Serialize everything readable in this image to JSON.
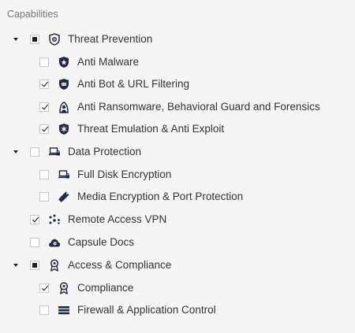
{
  "panel": {
    "title": "Capabilities"
  },
  "tree": {
    "threat_prevention": {
      "label": "Threat Prevention",
      "state": "partial",
      "expanded": true,
      "icon": "shield-gear-icon",
      "children": {
        "anti_malware": {
          "label": "Anti Malware",
          "state": "unchecked",
          "icon": "shield-bug-icon"
        },
        "anti_bot": {
          "label": "Anti Bot & URL Filtering",
          "state": "checked",
          "icon": "shield-bot-icon"
        },
        "anti_ransomware": {
          "label": "Anti Ransomware, Behavioral Guard and Forensics",
          "state": "checked",
          "icon": "hooded-figure-icon"
        },
        "threat_emulation": {
          "label": "Threat Emulation & Anti Exploit",
          "state": "checked",
          "icon": "sparkle-shield-icon"
        }
      }
    },
    "data_protection": {
      "label": "Data Protection",
      "state": "unchecked",
      "expanded": true,
      "icon": "laptop-lock-icon",
      "children": {
        "full_disk": {
          "label": "Full Disk Encryption",
          "state": "unchecked",
          "icon": "laptop-lock-icon"
        },
        "media_encryption": {
          "label": "Media Encryption & Port Protection",
          "state": "unchecked",
          "icon": "usb-pen-icon"
        }
      }
    },
    "remote_access": {
      "label": "Remote Access VPN",
      "state": "checked",
      "icon": "network-dots-icon"
    },
    "capsule_docs": {
      "label": "Capsule Docs",
      "state": "unchecked",
      "icon": "cloud-lock-icon"
    },
    "access_compliance": {
      "label": "Access & Compliance",
      "state": "partial",
      "expanded": true,
      "icon": "award-ribbon-icon",
      "children": {
        "compliance": {
          "label": "Compliance",
          "state": "checked",
          "icon": "award-ribbon-icon"
        },
        "firewall": {
          "label": "Firewall & Application Control",
          "state": "unchecked",
          "icon": "firewall-bars-icon"
        }
      }
    }
  }
}
